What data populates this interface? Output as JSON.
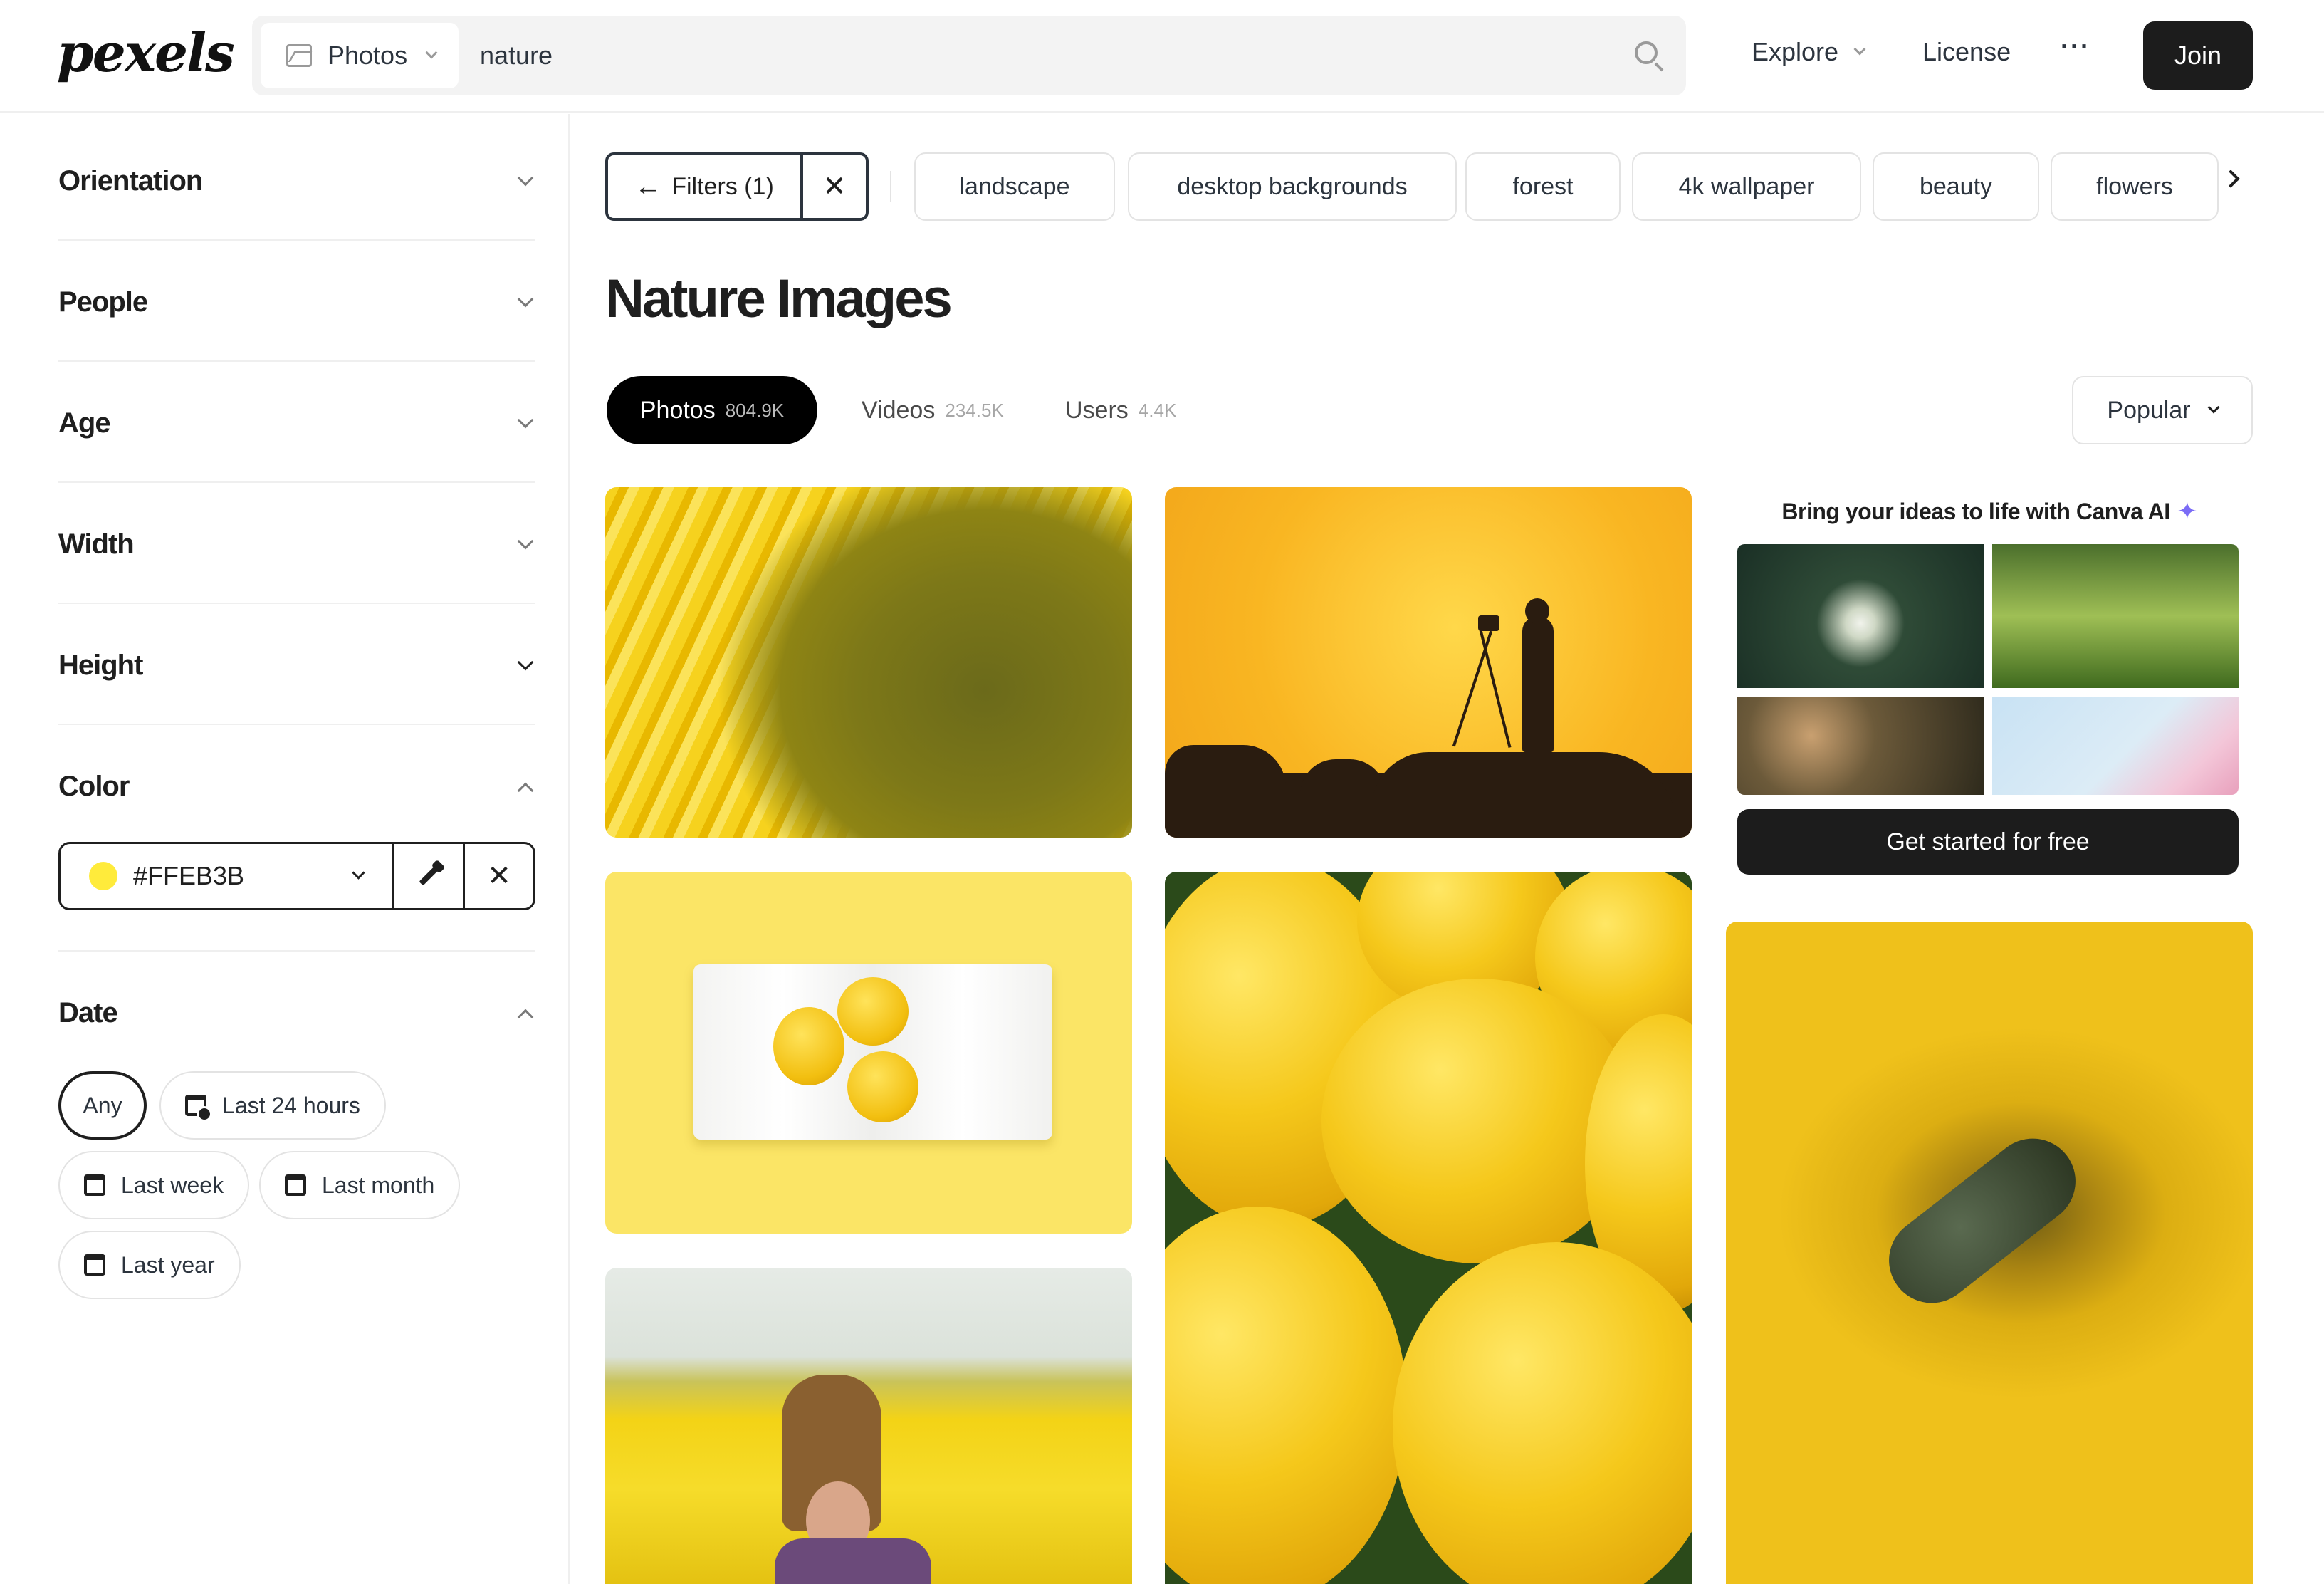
{
  "header": {
    "logo": "pexels",
    "search_type": "Photos",
    "search_value": "nature",
    "nav_explore": "Explore",
    "nav_license": "License",
    "nav_more": "···",
    "join_label": "Join"
  },
  "sidebar": {
    "filters": [
      {
        "label": "Orientation",
        "expanded": false
      },
      {
        "label": "People",
        "expanded": false
      },
      {
        "label": "Age",
        "expanded": false
      },
      {
        "label": "Width",
        "expanded": false
      },
      {
        "label": "Height",
        "expanded": false
      },
      {
        "label": "Color",
        "expanded": true
      },
      {
        "label": "Date",
        "expanded": true
      }
    ],
    "color": {
      "value": "#FFEB3B",
      "swatch": "#FFEB3B"
    },
    "date_options": [
      {
        "label": "Any",
        "selected": true
      },
      {
        "label": "Last 24 hours",
        "selected": false
      },
      {
        "label": "Last week",
        "selected": false
      },
      {
        "label": "Last month",
        "selected": false
      },
      {
        "label": "Last year",
        "selected": false
      }
    ]
  },
  "toolbar": {
    "filters_label": "Filters (1)",
    "chips": [
      "landscape",
      "desktop backgrounds",
      "forest",
      "4k wallpaper",
      "beauty",
      "flowers"
    ]
  },
  "page_title": "Nature Images",
  "tabs": [
    {
      "label": "Photos",
      "count": "804.9K",
      "active": true
    },
    {
      "label": "Videos",
      "count": "234.5K",
      "active": false
    },
    {
      "label": "Users",
      "count": "4.4K",
      "active": false
    }
  ],
  "sort": {
    "value": "Popular"
  },
  "ad": {
    "title": "Bring your ideas to life with Canva AI",
    "cta": "Get started for free"
  },
  "colors": {
    "accent_dark": "#1c1c1c",
    "selected_color": "#FFEB3B",
    "sparkle": "#7b6cf6"
  }
}
